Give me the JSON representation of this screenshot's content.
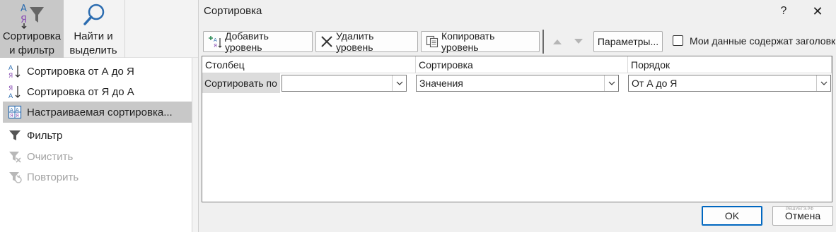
{
  "ribbon": {
    "sort_filter": {
      "line1": "Сортировка",
      "line2": "и фильтр"
    },
    "find_select": {
      "line1": "Найти и",
      "line2": "выделить"
    }
  },
  "menu": {
    "items": [
      {
        "label": "Сортировка от А до Я",
        "icon": "sort-az-icon",
        "state": "normal"
      },
      {
        "label": "Сортировка от Я до А",
        "icon": "sort-za-icon",
        "state": "normal"
      },
      {
        "label": "Настраиваемая сортировка...",
        "icon": "custom-sort-icon",
        "state": "selected"
      },
      {
        "label": "Фильтр",
        "icon": "filter-icon",
        "state": "normal"
      },
      {
        "label": "Очистить",
        "icon": "clear-filter-icon",
        "state": "disabled"
      },
      {
        "label": "Повторить",
        "icon": "reapply-icon",
        "state": "disabled"
      }
    ]
  },
  "dialog": {
    "title": "Сортировка",
    "help": "?",
    "close": "✕",
    "toolbar": {
      "add_level": "Добавить уровень",
      "delete_level": "Удалить уровень",
      "copy_level": "Копировать уровень",
      "options": "Параметры...",
      "has_headers": "Мои данные содержат заголовки",
      "has_headers_checked": false
    },
    "columns": {
      "column": "Столбец",
      "sort_on": "Сортировка",
      "order": "Порядок"
    },
    "row": {
      "label": "Сортировать по",
      "column_value": "",
      "sort_on_value": "Значения",
      "order_value": "От А до Я"
    },
    "ok": "OK",
    "cancel": "Отмена",
    "watermark": "РЕШУЕГЭ.РФ"
  },
  "colors": {
    "accent": "#0067c0",
    "selected_bg": "#c8c8c8",
    "disabled_text": "#a3a3a3"
  }
}
